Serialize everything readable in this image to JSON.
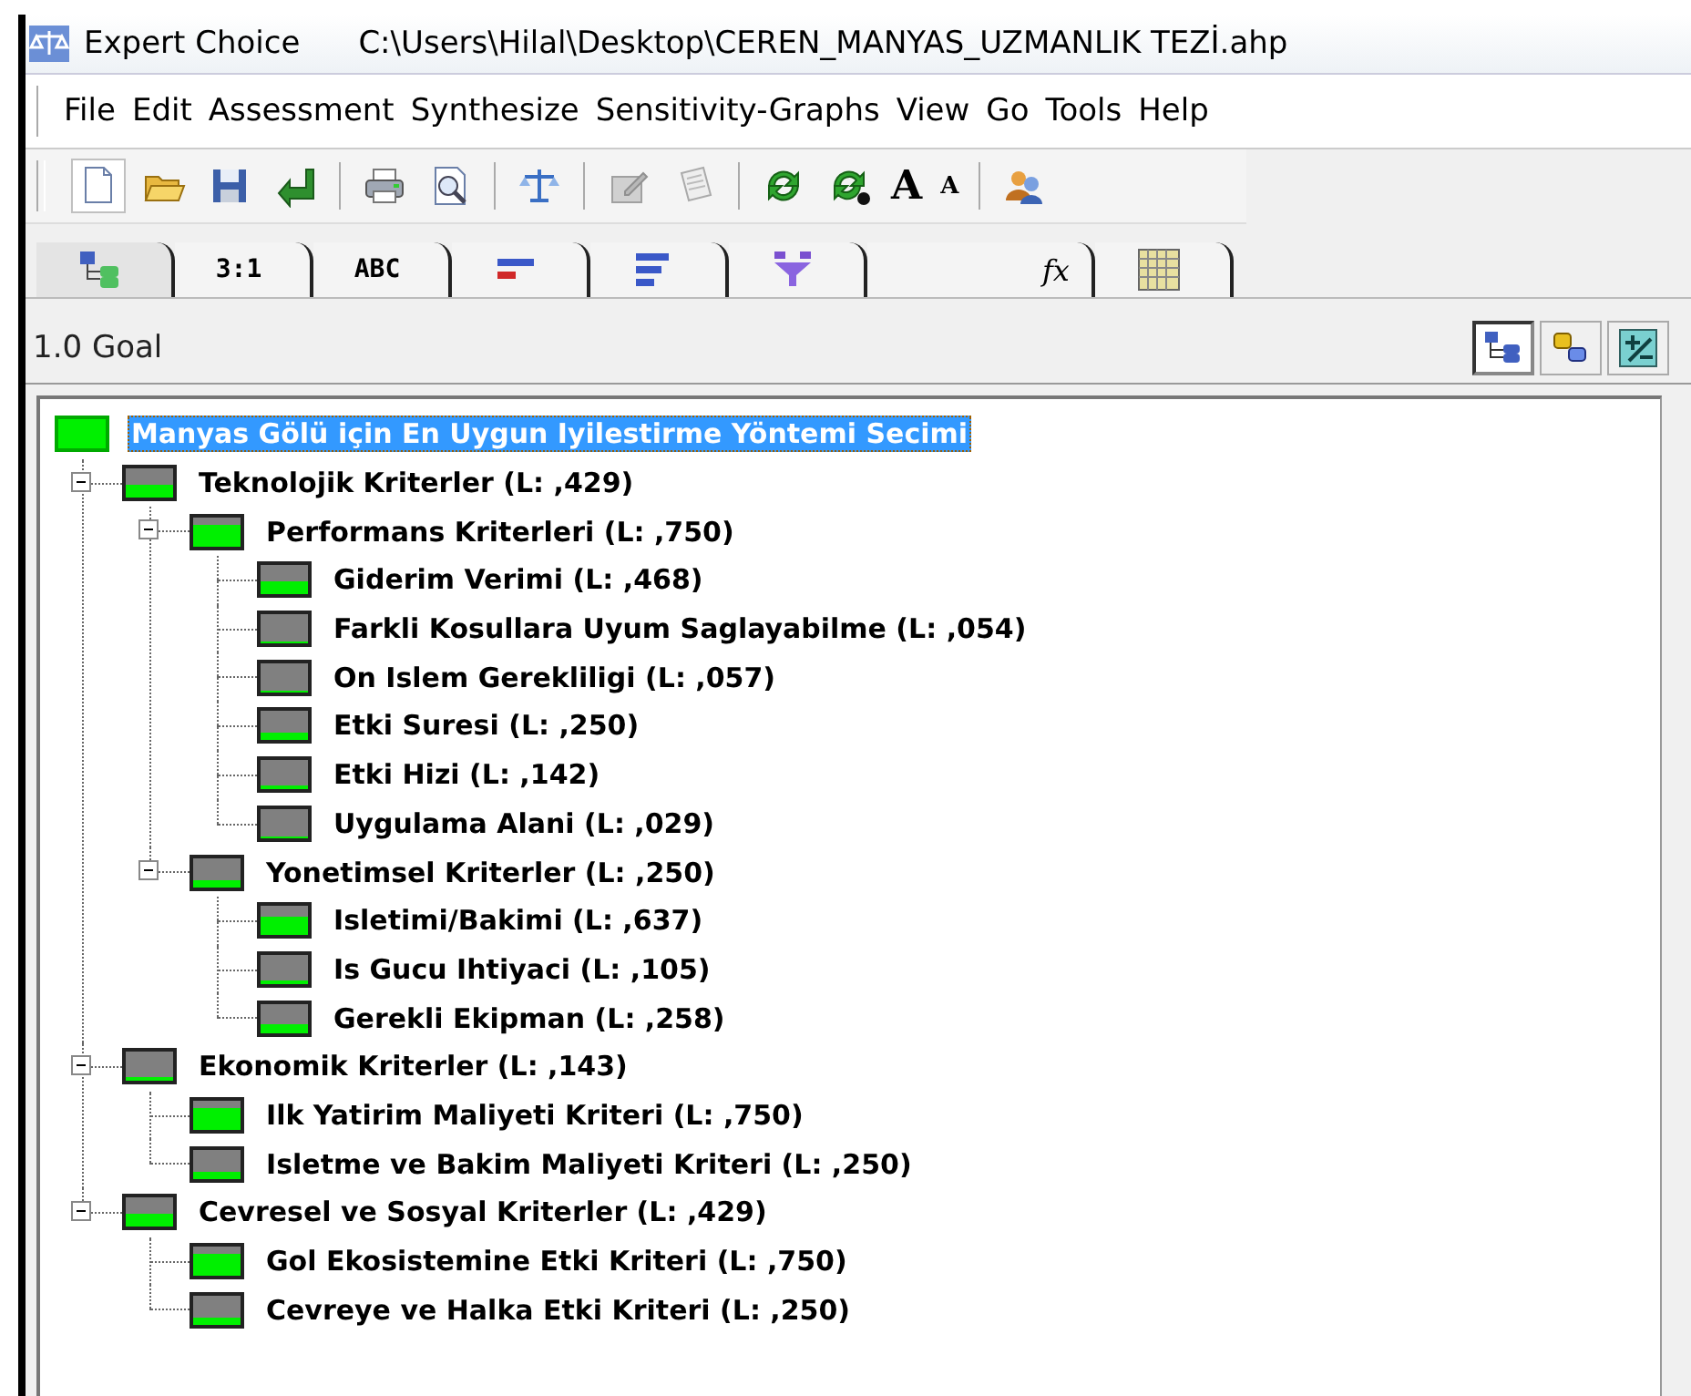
{
  "window": {
    "app_name": "Expert Choice",
    "file_path": "C:\\Users\\Hilal\\Desktop\\CEREN_MANYAS_UZMANLIK TEZİ.ahp"
  },
  "menu": [
    {
      "label": "File"
    },
    {
      "label": "Edit"
    },
    {
      "label": "Assessment"
    },
    {
      "label": "Synthesize"
    },
    {
      "label": "Sensitivity-Graphs"
    },
    {
      "label": "View"
    },
    {
      "label": "Go"
    },
    {
      "label": "Tools"
    },
    {
      "label": "Help"
    }
  ],
  "toolbar": [
    {
      "kind": "icon",
      "pressed": true
    },
    {
      "kind": "icon",
      "pressed": false
    },
    {
      "kind": "icon",
      "pressed": false
    },
    {
      "kind": "icon",
      "pressed": false
    },
    {
      "kind": "separator"
    },
    {
      "kind": "icon",
      "pressed": false
    },
    {
      "kind": "icon",
      "pressed": false
    },
    {
      "kind": "separator"
    },
    {
      "kind": "icon",
      "pressed": false
    },
    {
      "kind": "separator"
    },
    {
      "kind": "icon",
      "pressed": false
    },
    {
      "kind": "icon",
      "pressed": false
    },
    {
      "kind": "separator"
    },
    {
      "kind": "icon",
      "pressed": false
    },
    {
      "kind": "icon",
      "pressed": false
    },
    {
      "kind": "bigglyph",
      "text": "A"
    },
    {
      "kind": "smallglyph",
      "text": "A"
    },
    {
      "kind": "separator"
    },
    {
      "kind": "icon",
      "pressed": false
    }
  ],
  "tabs": [
    {
      "kind": "icon",
      "selected": true
    },
    {
      "kind": "text",
      "label": "3:1",
      "selected": false
    },
    {
      "kind": "text",
      "label": "ABC",
      "selected": false
    },
    {
      "kind": "icon",
      "selected": false
    },
    {
      "kind": "icon",
      "selected": false
    },
    {
      "kind": "icon",
      "selected": false
    },
    {
      "kind": "formula",
      "label": "fx",
      "selected": false
    },
    {
      "kind": "icon",
      "selected": false
    }
  ],
  "node_header": {
    "title": "1.0 Goal",
    "view_buttons": [
      {
        "selected": true
      },
      {
        "selected": false
      },
      {
        "selected": false
      }
    ]
  },
  "tree": {
    "label": "Manyas Gölü için En Uygun Iyilestirme Yöntemi Secimi",
    "selected": true,
    "children": [
      {
        "label": "Teknolojik Kriterler (L: ,429)",
        "selected": false,
        "expanded": true,
        "children": [
          {
            "label": "Performans Kriterleri (L: ,750)",
            "selected": false,
            "expanded": true,
            "children": [
              {
                "label": "Giderim Verimi (L: ,468)",
                "selected": false
              },
              {
                "label": "Farkli Kosullara Uyum Saglayabilme (L: ,054)",
                "selected": false
              },
              {
                "label": "On Islem Gerekliligi (L: ,057)",
                "selected": false
              },
              {
                "label": "Etki Suresi (L: ,250)",
                "selected": false
              },
              {
                "label": "Etki Hizi (L: ,142)",
                "selected": false
              },
              {
                "label": "Uygulama Alani (L: ,029)",
                "selected": false
              }
            ]
          },
          {
            "label": "Yonetimsel Kriterler (L: ,250)",
            "selected": false,
            "expanded": true,
            "children": [
              {
                "label": "Isletimi/Bakimi (L: ,637)",
                "selected": false
              },
              {
                "label": "Is Gucu Ihtiyaci (L: ,105)",
                "selected": false
              },
              {
                "label": "Gerekli Ekipman (L: ,258)",
                "selected": false
              }
            ]
          }
        ]
      },
      {
        "label": "Ekonomik Kriterler (L: ,143)",
        "selected": false,
        "expanded": true,
        "children": [
          {
            "label": "Ilk Yatirim Maliyeti Kriteri (L: ,750)",
            "selected": false
          },
          {
            "label": "Isletme ve Bakim Maliyeti Kriteri (L: ,250)",
            "selected": false
          }
        ]
      },
      {
        "label": "Cevresel ve Sosyal Kriterler (L: ,429)",
        "selected": false,
        "expanded": true,
        "children": [
          {
            "label": "Gol Ekosistemine Etki Kriteri (L: ,750)",
            "selected": false
          },
          {
            "label": "Cevreye ve Halka Etki Kriteri (L: ,250)",
            "selected": false
          }
        ]
      }
    ]
  }
}
